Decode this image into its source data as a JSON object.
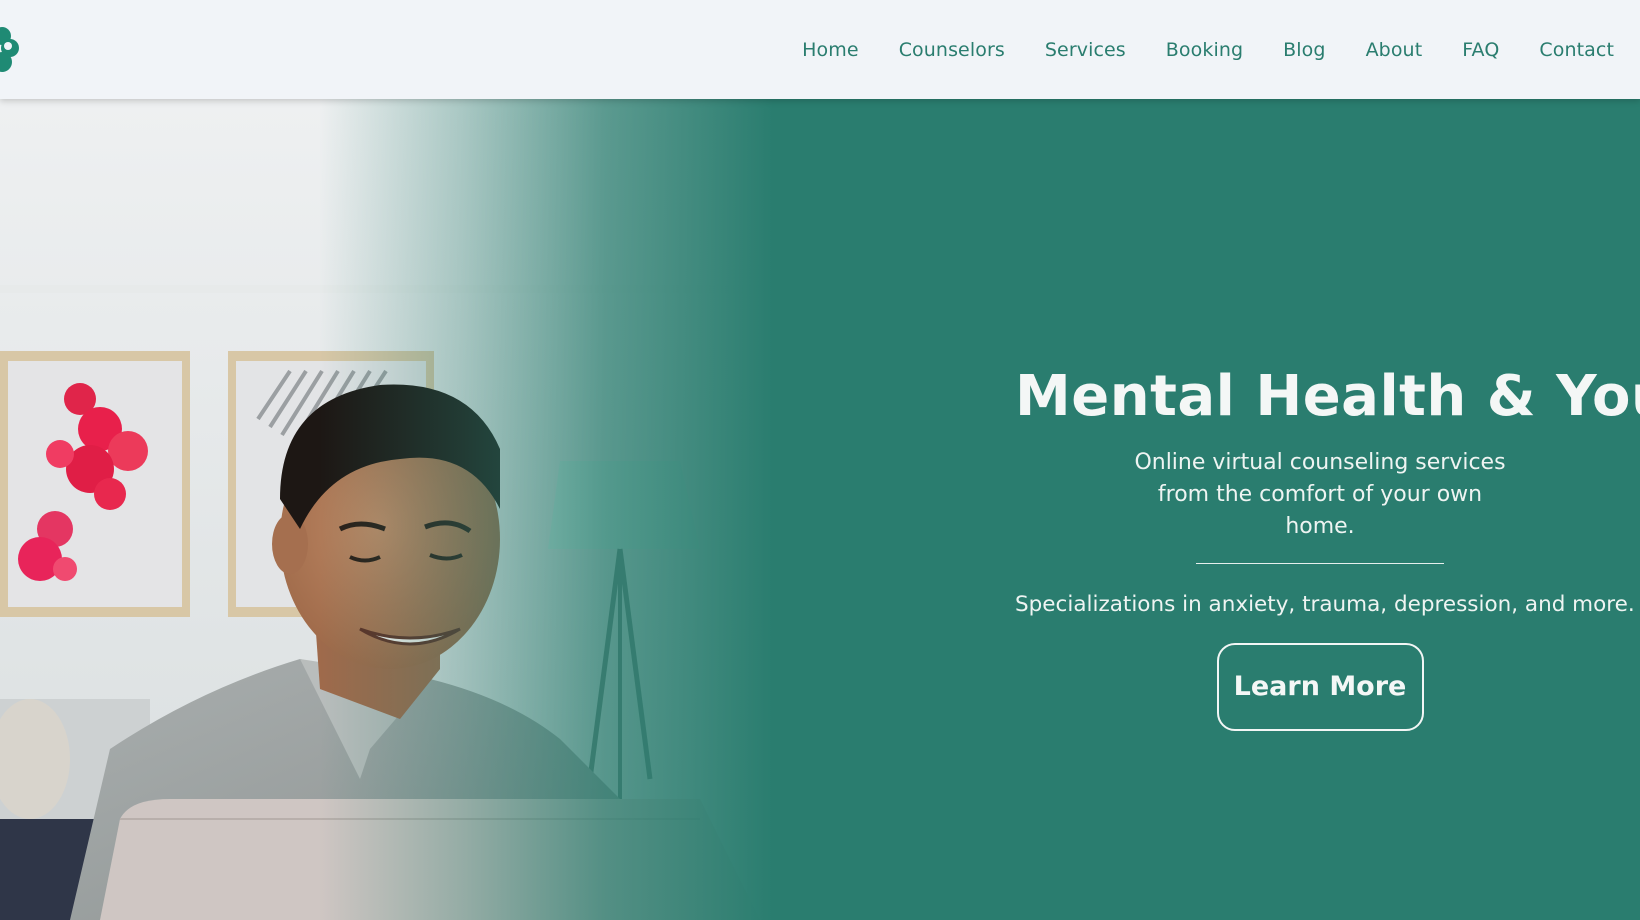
{
  "nav": {
    "items": [
      {
        "label": "Home"
      },
      {
        "label": "Counselors"
      },
      {
        "label": "Services"
      },
      {
        "label": "Booking"
      },
      {
        "label": "Blog"
      },
      {
        "label": "About"
      },
      {
        "label": "FAQ"
      },
      {
        "label": "Contact"
      }
    ]
  },
  "logo": {
    "icon": "leaf-cluster-icon"
  },
  "hero": {
    "title": "Mental Health & You",
    "subtitle": "Online virtual counseling services from the comfort of your own home.",
    "specializations": "Specializations in anxiety, trauma, depression, and more.",
    "cta_label": "Learn More"
  },
  "colors": {
    "brand": "#2a7d6f",
    "nav_background": "#f1f4f8",
    "hero_text": "#f4f7f6"
  }
}
